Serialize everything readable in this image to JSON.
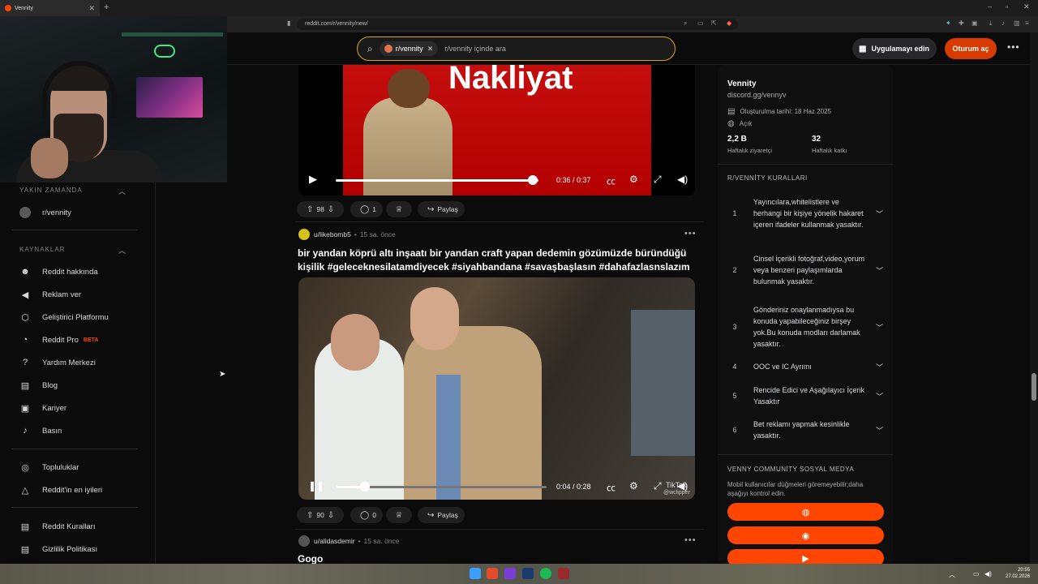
{
  "browser": {
    "tab_title": "Vennity",
    "new_tab_symbol": "+",
    "url": "reddit.com/r/vennity/new/"
  },
  "header": {
    "search_chip": "r/vennity",
    "search_placeholder": "r/vennity içinde ara",
    "app_button": "Uygulamayı edin",
    "login_button": "Oturum aç"
  },
  "left_nav": {
    "recent_heading": "YAKIN ZAMANDA",
    "recent_items": [
      {
        "label": "r/vennity"
      }
    ],
    "resources_heading": "KAYNAKLAR",
    "resources": [
      {
        "label": "Reddit hakkında",
        "icon": "reddit-alien-icon"
      },
      {
        "label": "Reklam ver",
        "icon": "megaphone-icon"
      },
      {
        "label": "Geliştirici Platformu",
        "icon": "developer-icon"
      },
      {
        "label": "Reddit Pro",
        "badge": "BETA",
        "icon": "pro-icon"
      },
      {
        "label": "Yardım Merkezi",
        "icon": "help-icon"
      },
      {
        "label": "Blog",
        "icon": "book-icon"
      },
      {
        "label": "Kariyer",
        "icon": "briefcase-icon"
      },
      {
        "label": "Basın",
        "icon": "microphone-icon"
      }
    ],
    "community_items": [
      {
        "label": "Topluluklar",
        "icon": "communities-icon"
      },
      {
        "label": "Reddit'in en iyileri",
        "icon": "best-of-icon"
      }
    ],
    "policy_items": [
      {
        "label": "Reddit Kuralları",
        "icon": "rules-icon"
      },
      {
        "label": "Gizlilik Politikası",
        "icon": "privacy-icon"
      }
    ]
  },
  "posts": [
    {
      "video_banner_text": "Nakliyat",
      "time": "0:36 / 0:37",
      "progress": 0.97,
      "votes": "98",
      "comments": "1",
      "share": "Paylaş"
    },
    {
      "author": "u/likebomb5",
      "age": "15 sa. önce",
      "title": "bir yandan köprü altı inşaatı bir yandan craft yapan dedemin gözümüzde büründüğü kişilik #geleceknesilatamdiyecek #siyahbandana #savaşbaşlasın #dahafazlasnslazım",
      "time": "0:04 / 0:28",
      "progress": 0.14,
      "watermark": "TikTok",
      "watermark_sub": "@wclipper",
      "votes": "90",
      "comments": "0",
      "share": "Paylaş"
    },
    {
      "author": "u/alidasdemir",
      "age": "15 sa. önce",
      "title": "Gogo"
    }
  ],
  "sidebar": {
    "name": "Vennity",
    "link": "discord.gg/vennyv",
    "created": "Oluşturulma tarihi: 18 Haz 2025",
    "visibility": "Açık",
    "weekly_visitors": "2,2 B",
    "weekly_visitors_label": "Haftalık ziyaretçi",
    "weekly_contributions": "32",
    "weekly_contributions_label": "Haftalık katkı",
    "rules_heading": "R/VENNİTY KURALLARI",
    "rules": [
      {
        "num": "1",
        "text": "Yayıncılara,whitelistlere ve herhangi bir kişiye yönelik hakaret içeren ifadeler kullanmak yasaktır."
      },
      {
        "num": "2",
        "text": "Cinsel içerikli fotoğraf,video,yorum veya benzeri paylaşımlarda bulunmak yasaktır."
      },
      {
        "num": "3",
        "text": "Gönderiniz onaylanmadıysa bu konuda yapabileceğiniz birşey yok.Bu konuda modları darlamak yasaktır."
      },
      {
        "num": "4",
        "text": "OOC ve IC Ayrımı"
      },
      {
        "num": "5",
        "text": "Rencide Edici ve Aşağılayıcı İçerik Yasaktır"
      },
      {
        "num": "6",
        "text": "Bet reklamı yapmak kesinlikle yasaktır."
      }
    ],
    "social_heading": "VENNY COMMUNİTY SOSYAL MEDYA",
    "social_desc": "Mobil kullanıcılar düğmeleri göremeyebilir;daha aşağıyı kontrol edin.",
    "social_buttons": [
      {
        "icon": "globe-icon"
      },
      {
        "icon": "discord-icon"
      },
      {
        "icon": "youtube-icon"
      }
    ]
  },
  "taskbar": {
    "time": "20:55",
    "date": "27.02.2026"
  },
  "colors": {
    "accent": "#ff4500",
    "login": "#d93a00",
    "search_border": "#d7a51a",
    "background": "#0b0b0b"
  }
}
